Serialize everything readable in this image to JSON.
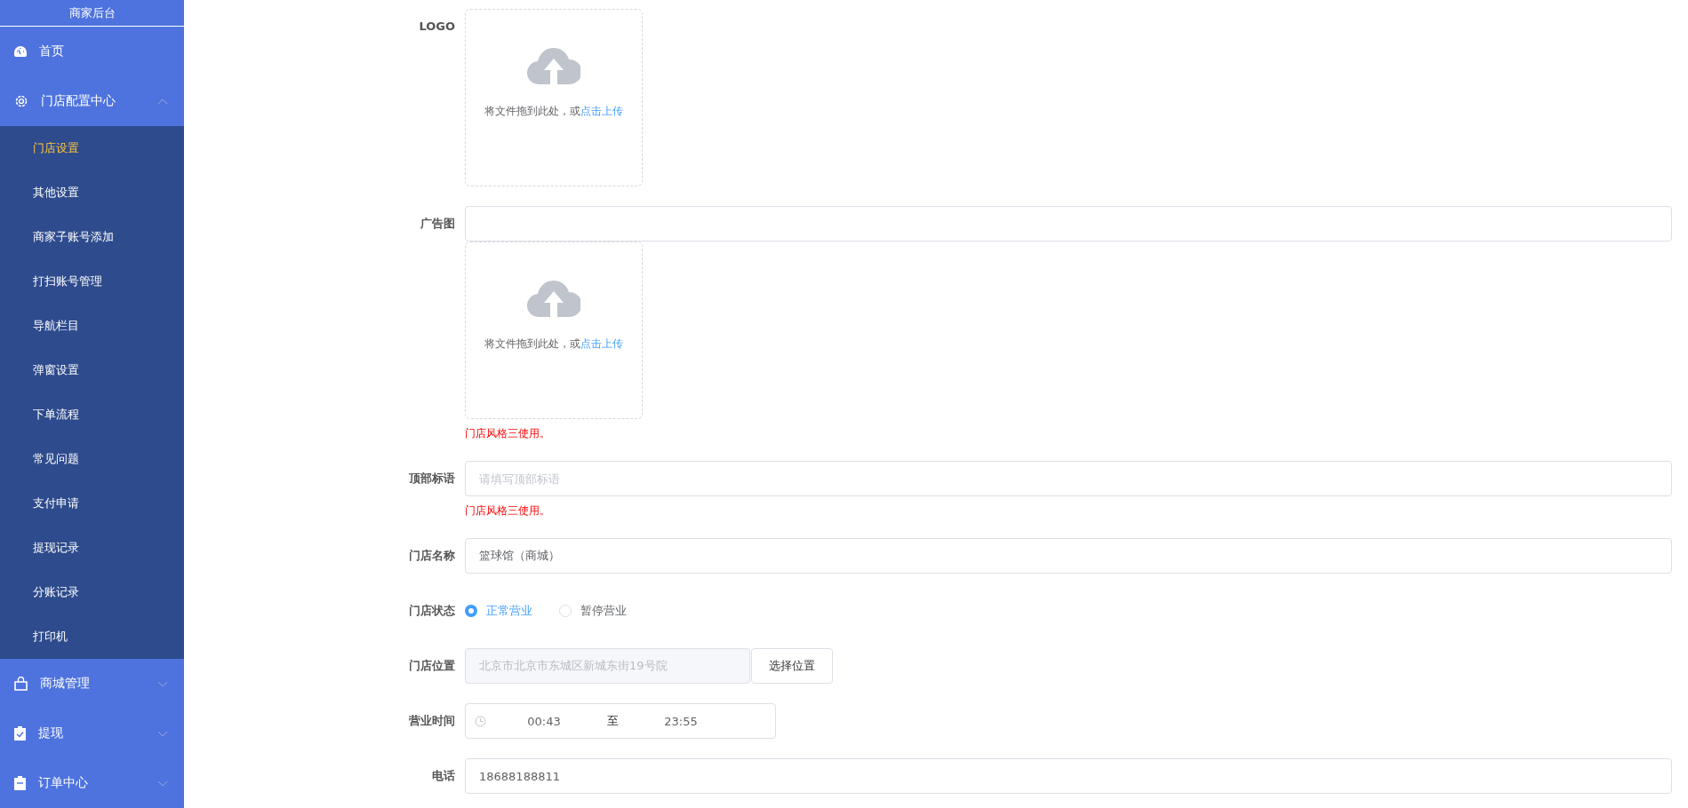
{
  "sidebar": {
    "title": "商家后台",
    "items": [
      {
        "label": "首页",
        "kind": "link"
      },
      {
        "label": "门店配置中心",
        "kind": "submenu",
        "expanded": true,
        "children": [
          {
            "label": "门店设置",
            "selected": true
          },
          {
            "label": "其他设置",
            "selected": false
          },
          {
            "label": "商家子账号添加",
            "selected": false
          },
          {
            "label": "打扫账号管理",
            "selected": false
          },
          {
            "label": "导航栏目",
            "selected": false
          },
          {
            "label": "弹窗设置",
            "selected": false
          },
          {
            "label": "下单流程",
            "selected": false
          },
          {
            "label": "常见问题",
            "selected": false
          },
          {
            "label": "支付申请",
            "selected": false
          },
          {
            "label": "提现记录",
            "selected": false
          },
          {
            "label": "分账记录",
            "selected": false
          },
          {
            "label": "打印机",
            "selected": false
          }
        ]
      },
      {
        "label": "商城管理",
        "kind": "submenu",
        "expanded": false
      },
      {
        "label": "提现",
        "kind": "submenu",
        "expanded": false
      },
      {
        "label": "订单中心",
        "kind": "submenu",
        "expanded": false
      }
    ]
  },
  "form": {
    "fields": [
      {
        "label": "LOGO",
        "kind": "upload",
        "upload": {
          "text": "将文件拖到此处，或",
          "link": "点击上传"
        }
      },
      {
        "label": "广告图",
        "kind": "input_upload",
        "upload": {
          "text": "将文件拖到此处，或",
          "link": "点击上传"
        },
        "hint": "门店风格三使用。"
      },
      {
        "label": "顶部标语",
        "kind": "input",
        "placeholder": "请填写顶部标语",
        "hint": "门店风格三使用。"
      },
      {
        "label": "门店名称",
        "kind": "input",
        "value": "篮球馆（商城）"
      },
      {
        "label": "门店状态",
        "kind": "radio",
        "options": [
          {
            "label": "正常营业",
            "selected": true
          },
          {
            "label": "暂停营业",
            "selected": false
          }
        ]
      },
      {
        "label": "门店位置",
        "kind": "location",
        "value": "北京市北京市东城区新城东街19号院",
        "disabled": true,
        "button": "选择位置"
      },
      {
        "label": "营业时间",
        "kind": "timerange",
        "start": "00:43",
        "separator": "至",
        "end": "23:55"
      },
      {
        "label": "电话",
        "kind": "input",
        "value": "18688188811"
      }
    ]
  }
}
